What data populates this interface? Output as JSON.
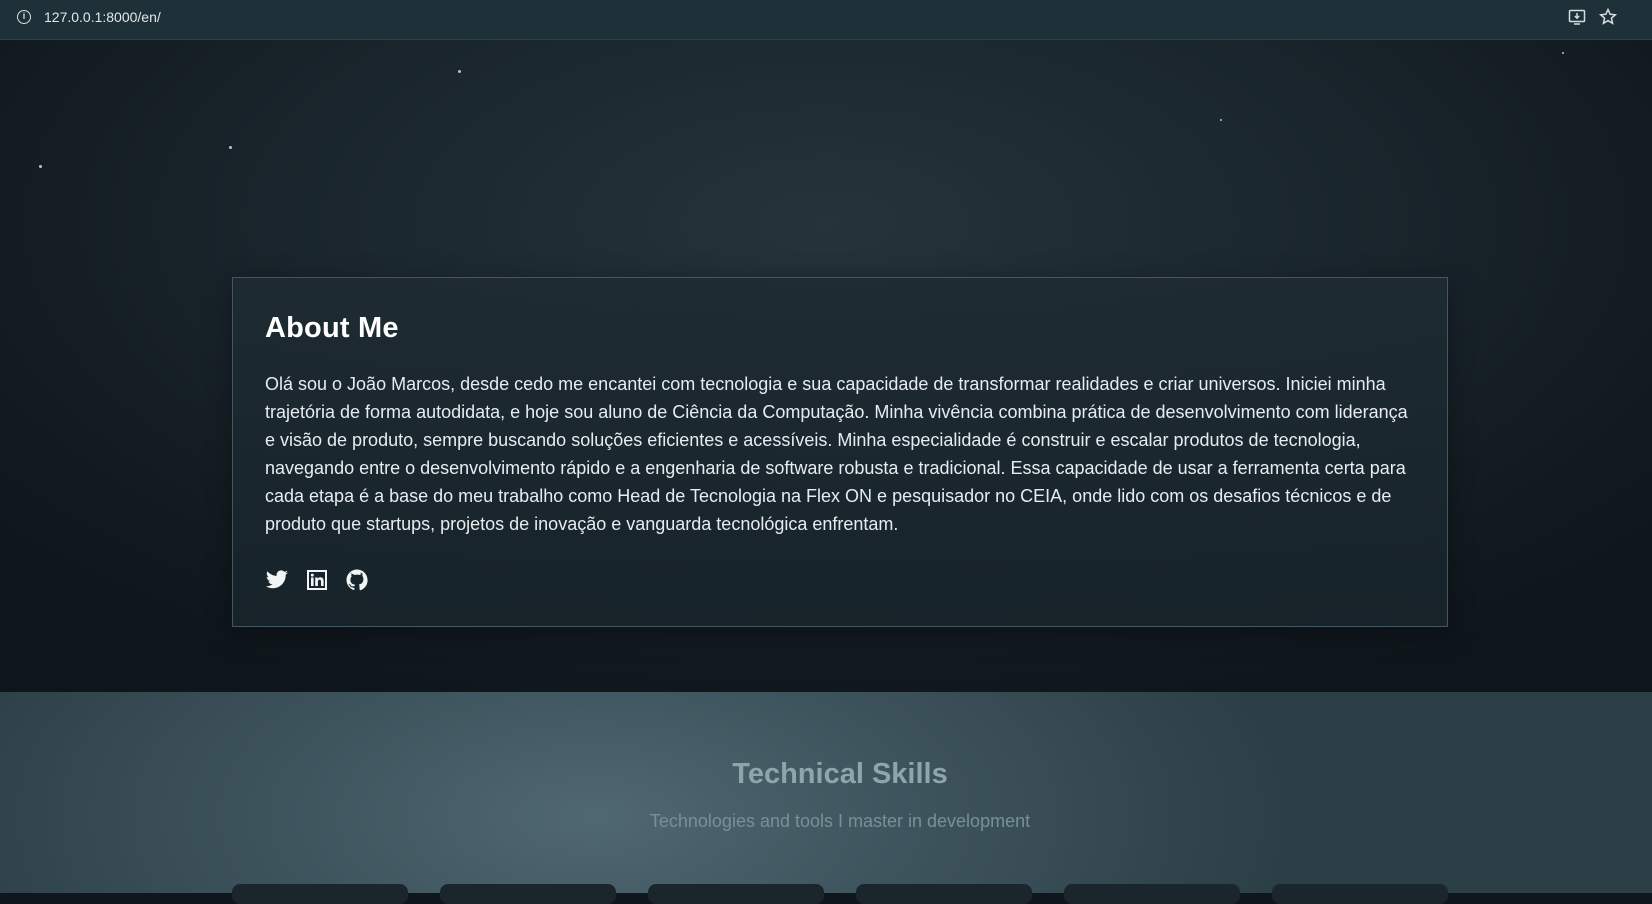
{
  "browser": {
    "url": "127.0.0.1:8000/en/",
    "icons": [
      "info-icon",
      "install-app-icon",
      "bookmark-star-icon"
    ]
  },
  "about": {
    "title": "About Me",
    "text": "Olá sou o João Marcos, desde cedo me encantei com tecnologia e sua capacidade de transformar realidades e criar universos. Iniciei minha trajetória de forma autodidata, e hoje sou aluno de Ciência da Computação. Minha vivência combina prática de desenvolvimento com liderança e visão de produto, sempre buscando soluções eficientes e acessíveis. Minha especialidade é construir e escalar produtos de tecnologia, navegando entre o desenvolvimento rápido e a engenharia de software robusta e tradicional. Essa capacidade de usar a ferramenta certa para cada etapa é a base do meu trabalho como Head de Tecnologia na Flex ON e pesquisador no CEIA, onde lido com os desafios técnicos e de produto que startups, projetos de inovação e vanguarda tecnológica enfrentam.",
    "social_icons": [
      "twitter-icon",
      "linkedin-icon",
      "github-icon"
    ]
  },
  "skills": {
    "title": "Technical Skills",
    "subtitle": "Technologies and tools I master in development"
  },
  "colors": {
    "hero_bg": "#1c2830",
    "card_border": "#46565e",
    "skills_bg": "#3e545d",
    "title_text": "#ffffff",
    "muted_title": "#8fa4ab"
  }
}
